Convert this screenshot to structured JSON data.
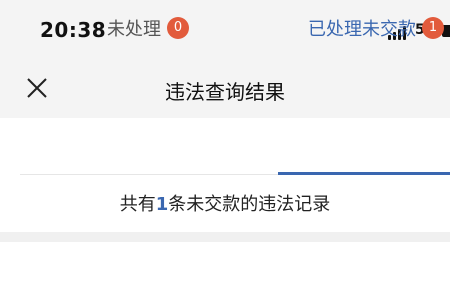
{
  "status_bar": {
    "time": "20:38",
    "network": "5G"
  },
  "nav": {
    "title": "违法查询结果"
  },
  "tabs": [
    {
      "label": "未处理",
      "badge": "0"
    },
    {
      "label": "已处理未交款",
      "badge": "1"
    }
  ],
  "summary": {
    "prefix": "共有",
    "count": "1",
    "suffix": "条未交款的违法记录"
  },
  "colors": {
    "accent": "#3a67b0",
    "badge": "#e25b3c",
    "header_bg": "#f4f4f4"
  },
  "icons": {
    "close": "close-icon",
    "signal": "signal-icon",
    "battery": "battery-icon"
  }
}
